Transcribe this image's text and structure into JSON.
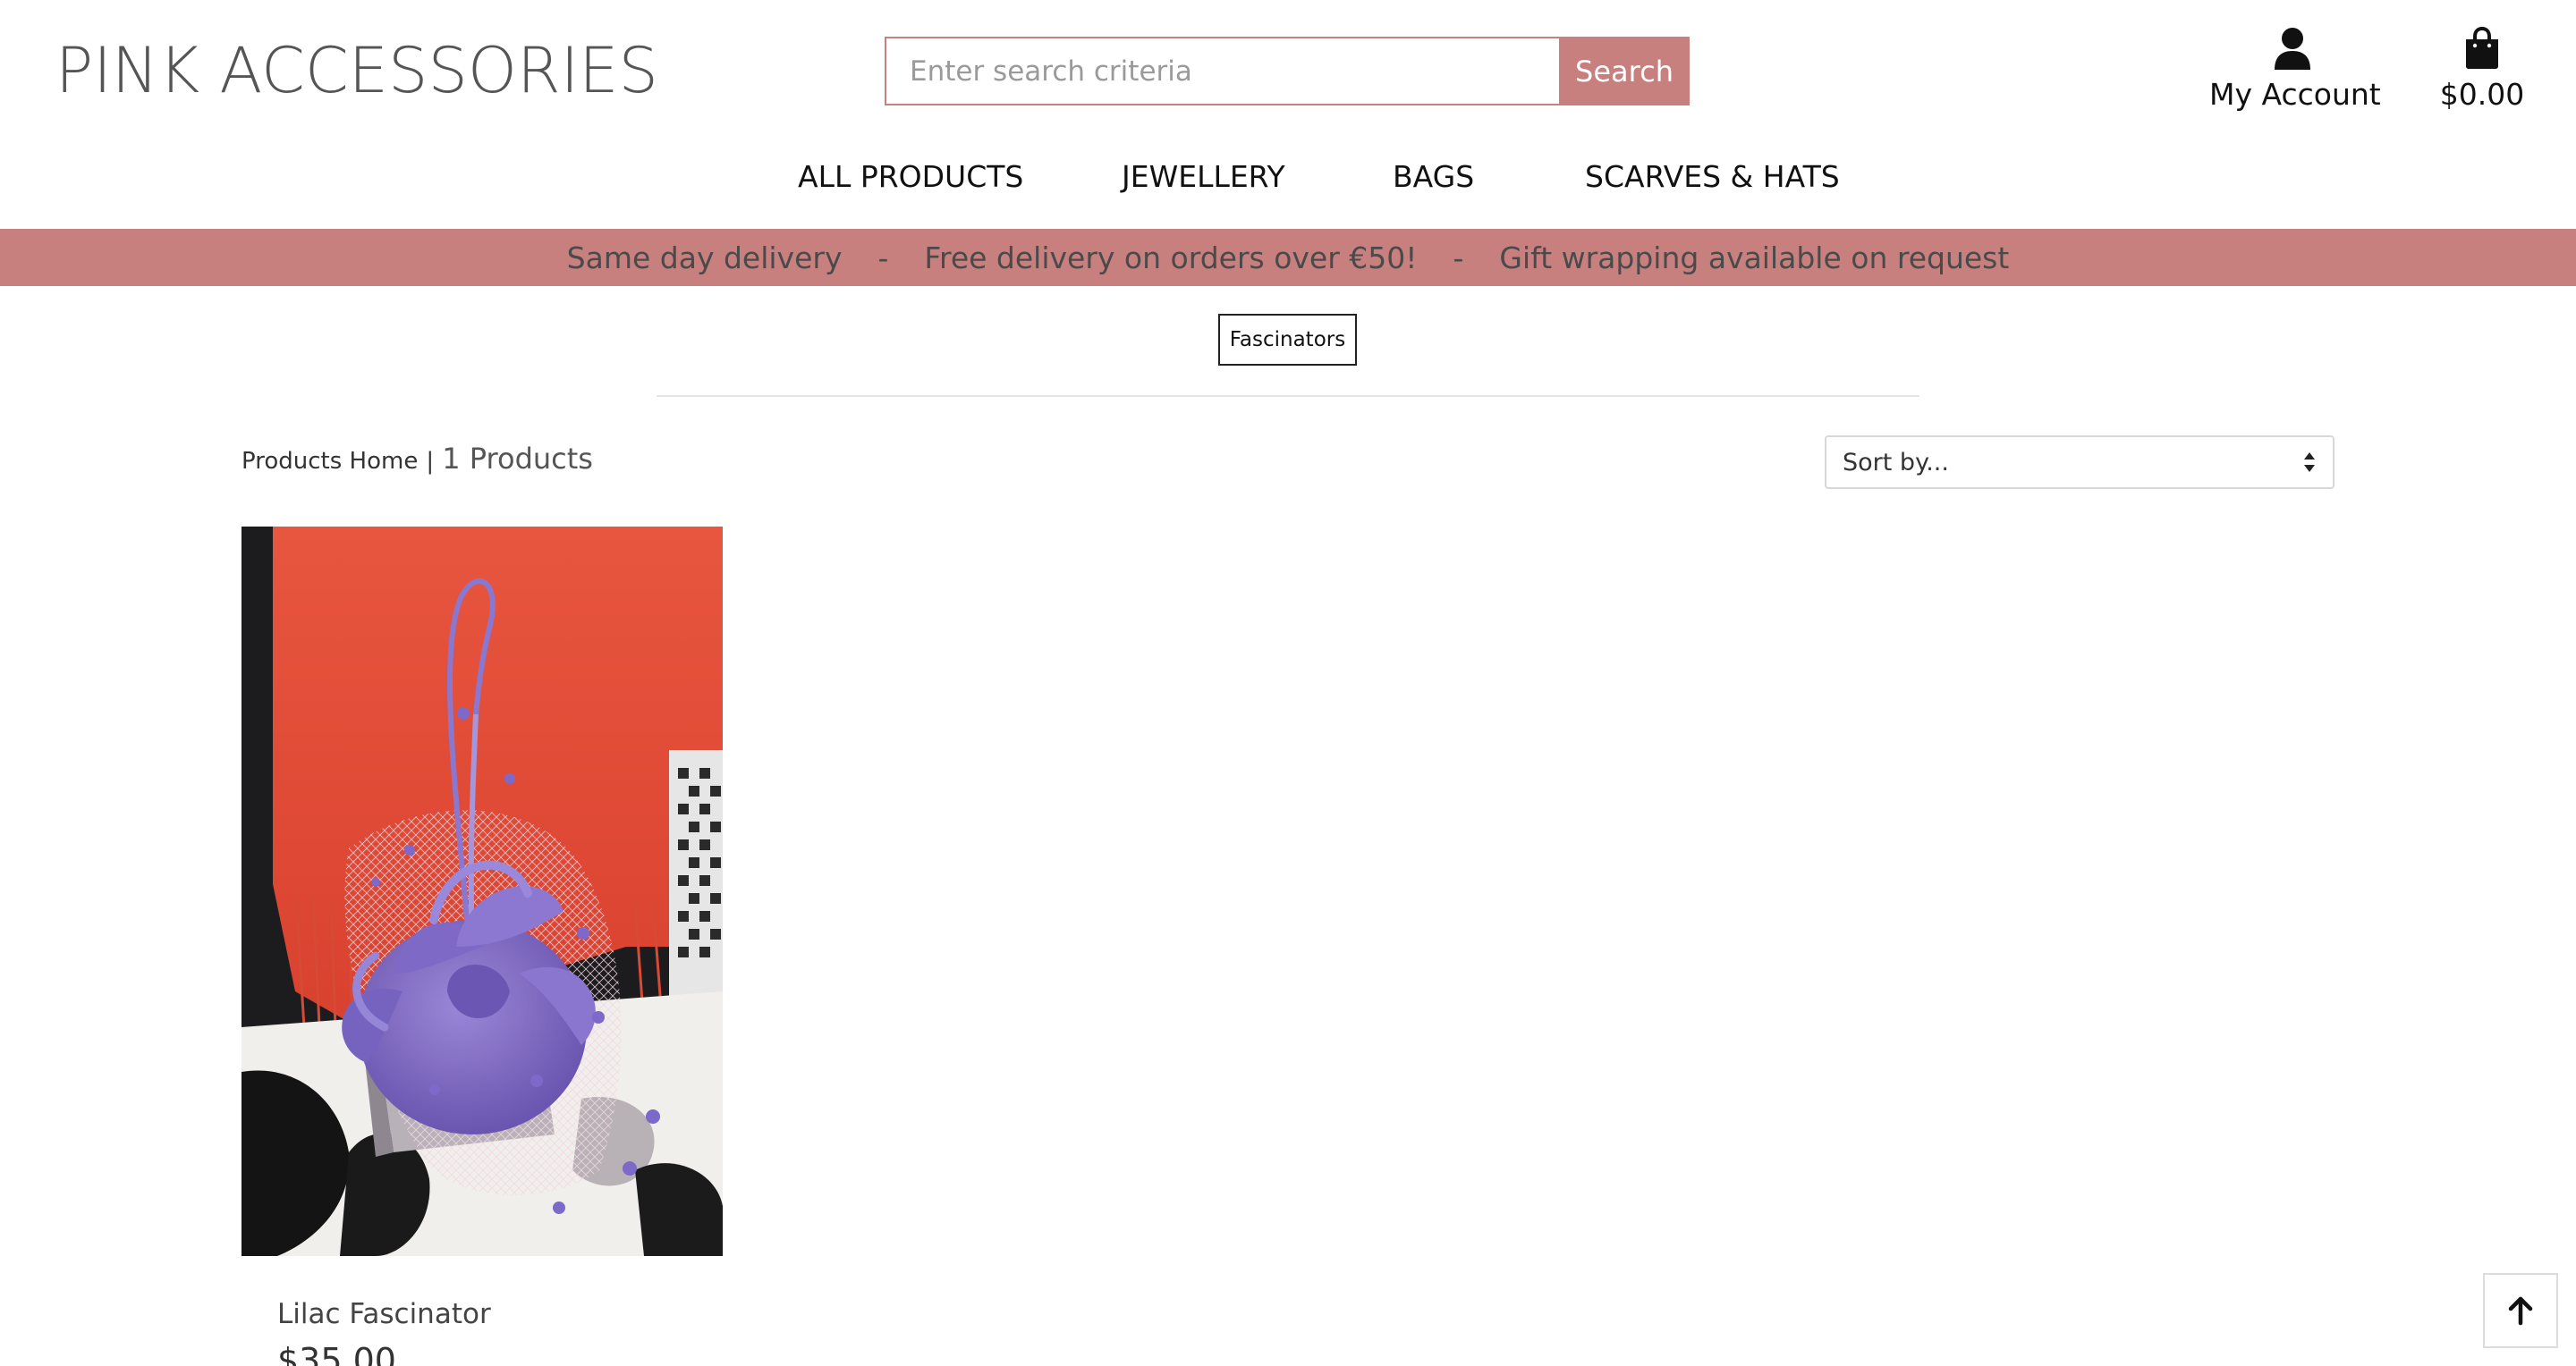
{
  "header": {
    "brand": "PINK ACCESSORIES",
    "search": {
      "placeholder": "Enter search criteria",
      "value": "",
      "button_label": "Search"
    },
    "account": {
      "label": "My Account",
      "icon": "user-icon"
    },
    "bag": {
      "label": "$0.00",
      "icon": "shopping-bag-icon"
    }
  },
  "nav": {
    "items": [
      {
        "label": "ALL PRODUCTS"
      },
      {
        "label": "JEWELLERY"
      },
      {
        "label": "BAGS"
      },
      {
        "label": "SCARVES & HATS"
      }
    ]
  },
  "banner": {
    "messages": [
      "Same day delivery",
      "Free delivery on orders over €50!",
      "Gift wrapping available on request"
    ],
    "separator": "-"
  },
  "category": {
    "label": "Fascinators"
  },
  "results": {
    "home_link": "Products Home",
    "pipe": "|",
    "count": "1 Products"
  },
  "sort": {
    "value": "Sort by..."
  },
  "products": [
    {
      "name": "Lilac Fascinator",
      "price": "$35.00"
    }
  ],
  "colors": {
    "accent": "#c8807f",
    "text": "#222222",
    "muted": "#555555"
  },
  "icons": {
    "back_to_top": "arrow-up-icon",
    "sort": "sort-arrows-icon"
  }
}
